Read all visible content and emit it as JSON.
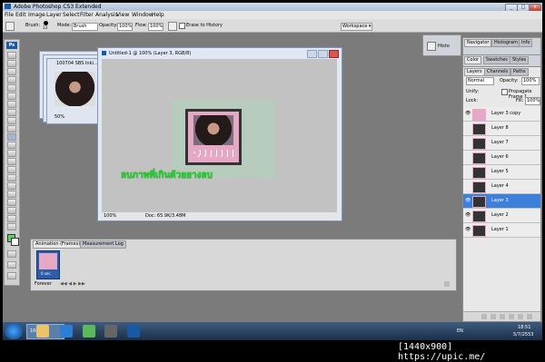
{
  "window": {
    "title": "Adobe Photoshop CS3 Extended",
    "controls": [
      "_",
      "□",
      "×"
    ]
  },
  "menu": [
    "File",
    "Edit",
    "Image",
    "Layer",
    "Select",
    "Filter",
    "Analysis",
    "View",
    "Window",
    "Help"
  ],
  "options_bar": {
    "brush_label": "Brush:",
    "brush_size": "13",
    "mode_label": "Mode:",
    "mode_value": "Brush",
    "opacity_label": "Opacity:",
    "opacity_value": "100%",
    "flow_label": "Flow:",
    "flow_value": "100%",
    "erase_history_label": "Erase to History",
    "workspace_label": "Workspace ▾"
  },
  "stacked_window": {
    "title": "100704 SBS Inki...",
    "zoom": "50%"
  },
  "document": {
    "title": "Untitled-1 @ 100% (Layer 3, RGB/8)",
    "zoom": "100%",
    "doc_info": "Doc: 65.9K/3.48M",
    "overlay_text": "ลบภาพที่เกินด้วยยางลบ"
  },
  "panels_top": {
    "navigator_tab": "Navigator",
    "histogram_tab": "Histogram",
    "info_tab": "Info",
    "history_label": "Histo"
  },
  "color_panel": {
    "tabs": [
      "Color",
      "Swatches",
      "Styles"
    ]
  },
  "layers_panel": {
    "tabs": [
      "Layers",
      "Channels",
      "Paths"
    ],
    "blend_mode": "Normal",
    "opacity_label": "Opacity:",
    "opacity_value": "100%",
    "unify_label": "Unify:",
    "propagate_label": "Propagate Frame 1",
    "lock_label": "Lock:",
    "fill_label": "Fill:",
    "fill_value": "100%",
    "layers": [
      "Layer 3 copy",
      "Layer 8",
      "Layer 7",
      "Layer 6",
      "Layer 5",
      "Layer 4",
      "Layer 3",
      "Layer 2",
      "Layer 1"
    ],
    "selected": "Layer 3"
  },
  "animation_panel": {
    "tabs": [
      "Animation (Frames) ×",
      "Measurement Log"
    ],
    "frame_delay": "0 sec.",
    "loop": "Forever"
  },
  "taskbar": {
    "task_label": "100...",
    "lang": "EN",
    "time": "18:51",
    "date": "5/7/2553"
  },
  "caption": "[1440x900] https://upic.me/"
}
